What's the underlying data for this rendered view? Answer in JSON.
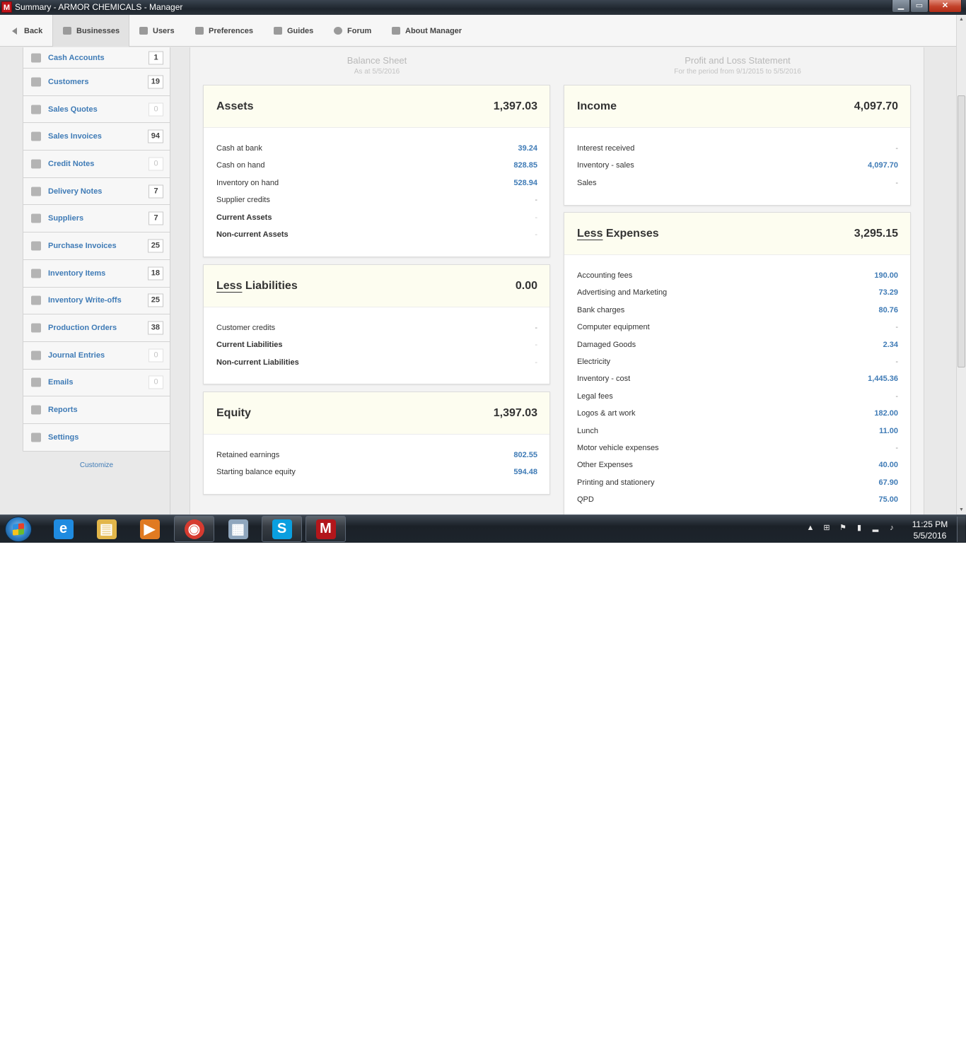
{
  "window": {
    "title": "Summary - ARMOR CHEMICALS - Manager",
    "app_icon_letter": "M",
    "btn_minimize": "▁",
    "btn_maximize": "▭",
    "btn_close": "✕"
  },
  "nav": {
    "items": [
      {
        "label": "Back",
        "icon": "back-arrow-icon"
      },
      {
        "label": "Businesses",
        "icon": "building-icon",
        "active": true
      },
      {
        "label": "Users",
        "icon": "users-icon"
      },
      {
        "label": "Preferences",
        "icon": "preferences-icon"
      },
      {
        "label": "Guides",
        "icon": "book-icon"
      },
      {
        "label": "Forum",
        "icon": "chat-icon"
      },
      {
        "label": "About Manager",
        "icon": "manager-logo-icon"
      }
    ]
  },
  "sidebar": {
    "items": [
      {
        "label": "Cash Accounts",
        "count": "1",
        "icon": "cash-accounts-icon"
      },
      {
        "label": "Customers",
        "count": "19",
        "icon": "customers-icon"
      },
      {
        "label": "Sales Quotes",
        "count": "0",
        "icon": "sales-quotes-icon"
      },
      {
        "label": "Sales Invoices",
        "count": "94",
        "icon": "sales-invoices-icon"
      },
      {
        "label": "Credit Notes",
        "count": "0",
        "icon": "credit-notes-icon"
      },
      {
        "label": "Delivery Notes",
        "count": "7",
        "icon": "delivery-notes-icon"
      },
      {
        "label": "Suppliers",
        "count": "7",
        "icon": "suppliers-icon"
      },
      {
        "label": "Purchase Invoices",
        "count": "25",
        "icon": "purchase-invoices-icon"
      },
      {
        "label": "Inventory Items",
        "count": "18",
        "icon": "inventory-items-icon"
      },
      {
        "label": "Inventory Write-offs",
        "count": "25",
        "icon": "inventory-writeoffs-icon"
      },
      {
        "label": "Production Orders",
        "count": "38",
        "icon": "production-orders-icon"
      },
      {
        "label": "Journal Entries",
        "count": "0",
        "icon": "journal-entries-icon"
      },
      {
        "label": "Emails",
        "count": "0",
        "icon": "emails-icon"
      },
      {
        "label": "Reports",
        "count": "",
        "icon": "printer-icon"
      },
      {
        "label": "Settings",
        "count": "",
        "icon": "settings-gear-icon"
      }
    ],
    "customize": "Customize"
  },
  "balance_sheet": {
    "heading": "Balance Sheet",
    "subheading": "As at 5/5/2016",
    "assets": {
      "title": "Assets",
      "total": "1,397.03",
      "rows": [
        {
          "label": "Cash at bank",
          "value": "39.24"
        },
        {
          "label": "Cash on hand",
          "value": "828.85"
        },
        {
          "label": "Inventory on hand",
          "value": "528.94"
        },
        {
          "label": "Supplier credits",
          "value": "-"
        },
        {
          "label": "Current Assets",
          "value": "-",
          "bold": true
        },
        {
          "label": "Non-current Assets",
          "value": "-",
          "bold": true
        }
      ]
    },
    "liabilities": {
      "less": "Less",
      "title": "Liabilities",
      "total": "0.00",
      "rows": [
        {
          "label": "Customer credits",
          "value": "-"
        },
        {
          "label": "Current Liabilities",
          "value": "-",
          "bold": true
        },
        {
          "label": "Non-current Liabilities",
          "value": "-",
          "bold": true
        }
      ]
    },
    "equity": {
      "title": "Equity",
      "total": "1,397.03",
      "rows": [
        {
          "label": "Retained earnings",
          "value": "802.55"
        },
        {
          "label": "Starting balance equity",
          "value": "594.48"
        }
      ]
    }
  },
  "profit_loss": {
    "heading": "Profit and Loss Statement",
    "subheading": "For the period from 9/1/2015 to 5/5/2016",
    "income": {
      "title": "Income",
      "total": "4,097.70",
      "rows": [
        {
          "label": "Interest received",
          "value": "-"
        },
        {
          "label": "Inventory - sales",
          "value": "4,097.70"
        },
        {
          "label": "Sales",
          "value": "-"
        }
      ]
    },
    "expenses": {
      "less": "Less",
      "title": "Expenses",
      "total": "3,295.15",
      "rows": [
        {
          "label": "Accounting fees",
          "value": "190.00"
        },
        {
          "label": "Advertising and Marketing",
          "value": "73.29"
        },
        {
          "label": "Bank charges",
          "value": "80.76"
        },
        {
          "label": "Computer equipment",
          "value": "-"
        },
        {
          "label": "Damaged Goods",
          "value": "2.34"
        },
        {
          "label": "Electricity",
          "value": "-"
        },
        {
          "label": "Inventory - cost",
          "value": "1,445.36"
        },
        {
          "label": "Legal fees",
          "value": "-"
        },
        {
          "label": "Logos & art work",
          "value": "182.00"
        },
        {
          "label": "Lunch",
          "value": "11.00"
        },
        {
          "label": "Motor vehicle expenses",
          "value": "-"
        },
        {
          "label": "Other Expenses",
          "value": "40.00"
        },
        {
          "label": "Printing and stationery",
          "value": "67.90"
        },
        {
          "label": "QPD",
          "value": "75.00"
        }
      ]
    }
  },
  "taskbar": {
    "apps": [
      {
        "name": "internet-explorer",
        "glyph": "e",
        "color": "#1f8be0"
      },
      {
        "name": "file-explorer",
        "glyph": "▤",
        "color": "#e2b64a"
      },
      {
        "name": "media-player",
        "glyph": "▶",
        "color": "#e07a22"
      },
      {
        "name": "chrome",
        "glyph": "◉",
        "color": "#d63b30",
        "open": true
      },
      {
        "name": "calculator",
        "glyph": "▦",
        "color": "#8fa6bd"
      },
      {
        "name": "skype",
        "glyph": "S",
        "color": "#0a9fe0",
        "open": true
      },
      {
        "name": "manager",
        "glyph": "M",
        "color": "#b3161b",
        "open": true
      }
    ],
    "tray_icons": [
      "show-hidden-icons-arrow",
      "windows-flag-icon",
      "action-center-flag-icon",
      "power-icon",
      "network-signal-icon",
      "volume-icon"
    ],
    "tray_glyphs": [
      "▲",
      "⊞",
      "⚑",
      "▮",
      "▂",
      "♪"
    ],
    "time": "11:25 PM",
    "date": "5/5/2016"
  }
}
